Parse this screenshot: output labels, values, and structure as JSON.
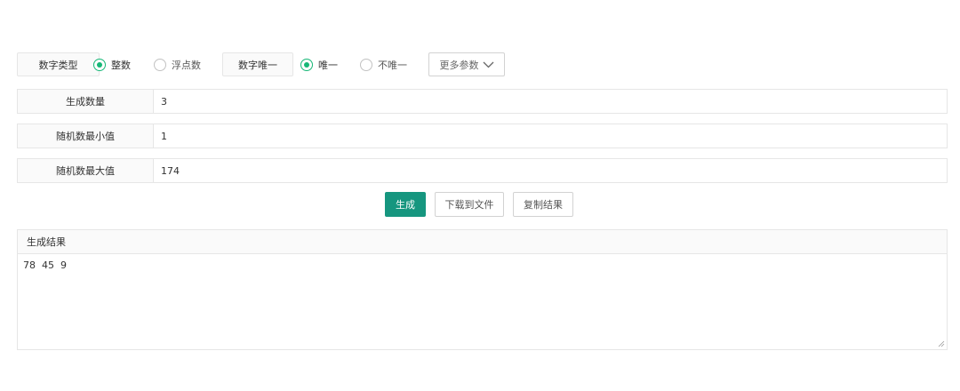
{
  "options": {
    "number_type_label": "数字类型",
    "integer_label": "整数",
    "float_label": "浮点数",
    "unique_label": "数字唯一",
    "unique_yes_label": "唯一",
    "unique_no_label": "不唯一",
    "more_params_label": "更多参数",
    "number_type_selected": "整数",
    "unique_selected": "唯一"
  },
  "fields": {
    "count_label": "生成数量",
    "count_value": "3",
    "min_label": "随机数最小值",
    "min_value": "1",
    "max_label": "随机数最大值",
    "max_value": "174"
  },
  "actions": {
    "generate_label": "生成",
    "download_label": "下载到文件",
    "copy_label": "复制结果"
  },
  "result": {
    "title": "生成结果",
    "text": "78  45  9"
  },
  "colors": {
    "accent": "#16b777",
    "primary_button": "#16967f"
  }
}
